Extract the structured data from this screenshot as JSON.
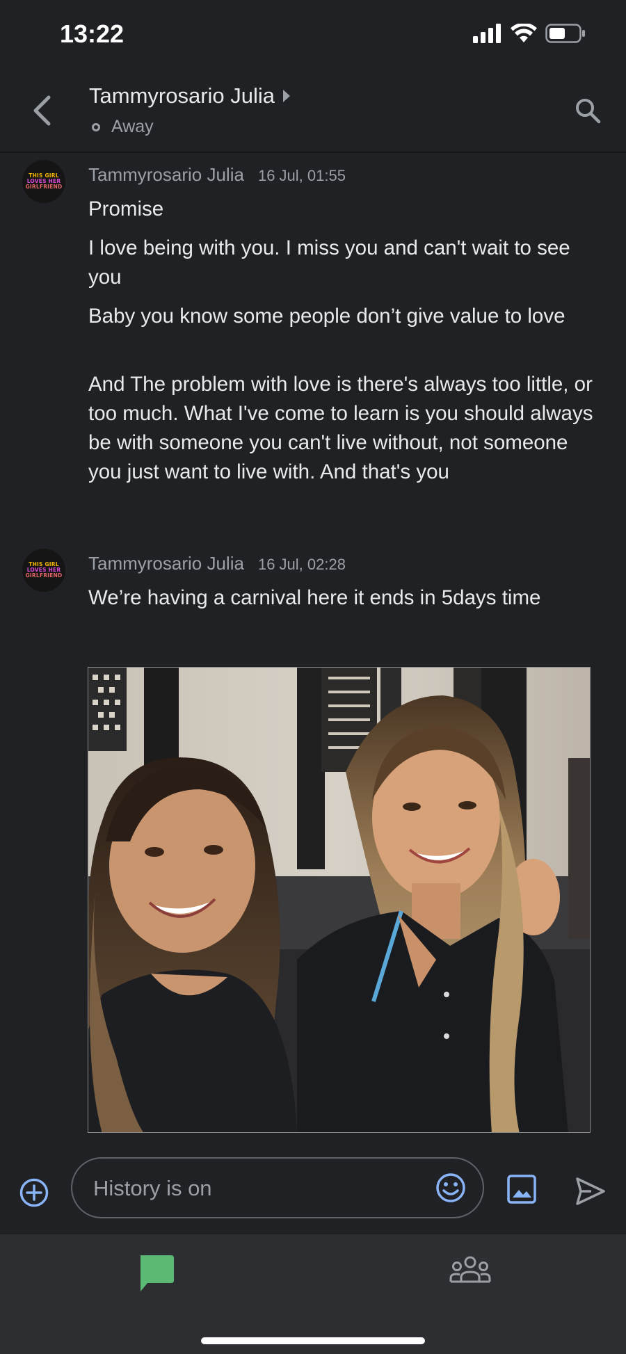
{
  "status_bar": {
    "time": "13:22"
  },
  "header": {
    "title": "Tammyrosario Julia",
    "presence": "Away"
  },
  "messages": [
    {
      "sender": "Tammyrosario Julia",
      "timestamp": "16 Jul, 01:55",
      "avatar_text": [
        "THIS GIRL",
        "LOVES HER",
        "GIRLFRIEND"
      ],
      "lines": [
        "Promise",
        "I love being with you. I miss you and can't wait to see you",
        "Baby you know some people don’t give value to love",
        "And The problem with love is there's always too little, or too much. What I've come to learn is you should always be with someone you can't live without, not someone you just want to live with. And that's you"
      ]
    },
    {
      "sender": "Tammyrosario Julia",
      "timestamp": "16 Jul, 02:28",
      "avatar_text": [
        "THIS GIRL",
        "LOVES HER",
        "GIRLFRIEND"
      ],
      "lines": [
        "We’re having a carnival here it ends in 5days time"
      ]
    }
  ],
  "composer": {
    "placeholder": "History is on"
  },
  "icons": {
    "back": "back-arrow-icon",
    "search": "search-icon",
    "add": "add-circle-icon",
    "emoji": "emoji-icon",
    "image": "image-icon",
    "send": "send-icon",
    "chat_tab": "chat-icon",
    "rooms_tab": "group-icon"
  },
  "colors": {
    "background": "#202124",
    "accent_blue": "#8ab4f8",
    "chat_green": "#5bb974",
    "secondary_text": "#9aa0a6"
  }
}
